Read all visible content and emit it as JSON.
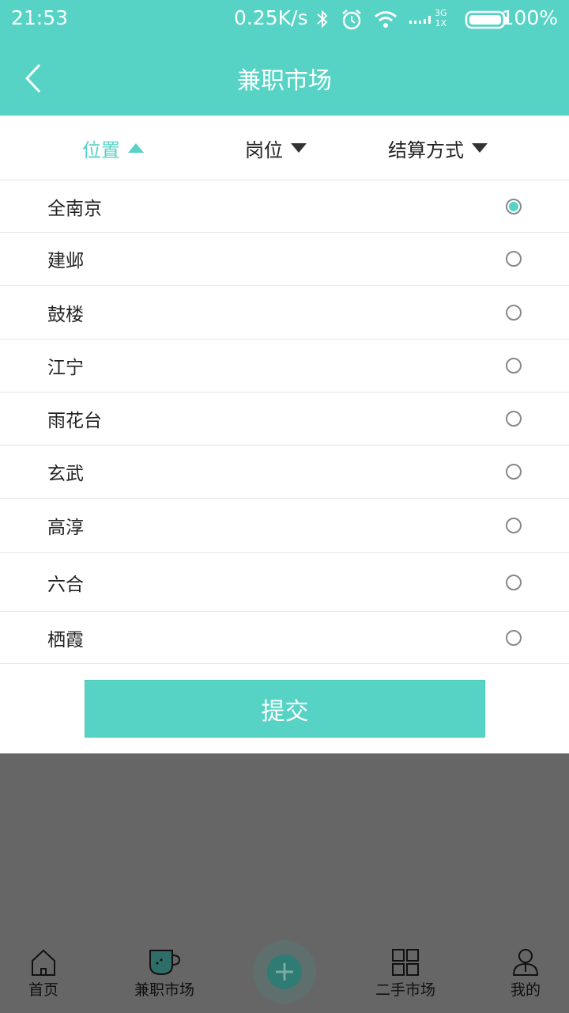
{
  "status_bar": {
    "time": "21:53",
    "speed": "0.25K/s",
    "network_top": "3G",
    "network_bottom": "1X",
    "battery": "100%"
  },
  "header": {
    "title": "兼职市场"
  },
  "filters": [
    {
      "label": "位置",
      "active": true
    },
    {
      "label": "岗位",
      "active": false
    },
    {
      "label": "结算方式",
      "active": false
    }
  ],
  "options": [
    {
      "label": "全南京",
      "selected": true
    },
    {
      "label": "建邺",
      "selected": false
    },
    {
      "label": "鼓楼",
      "selected": false
    },
    {
      "label": "江宁",
      "selected": false
    },
    {
      "label": "雨花台",
      "selected": false
    },
    {
      "label": "玄武",
      "selected": false
    },
    {
      "label": "高淳",
      "selected": false
    },
    {
      "label": "六合",
      "selected": false
    },
    {
      "label": "栖霞",
      "selected": false
    }
  ],
  "submit_label": "提交",
  "bottom_nav": [
    {
      "label": "首页",
      "icon": "home-icon"
    },
    {
      "label": "兼职市场",
      "icon": "cup-icon"
    },
    {
      "label": "",
      "icon": "plus-icon"
    },
    {
      "label": "二手市场",
      "icon": "grid-icon"
    },
    {
      "label": "我的",
      "icon": "user-icon"
    }
  ],
  "colors": {
    "accent": "#56d3c5",
    "overlay": "#666666"
  }
}
